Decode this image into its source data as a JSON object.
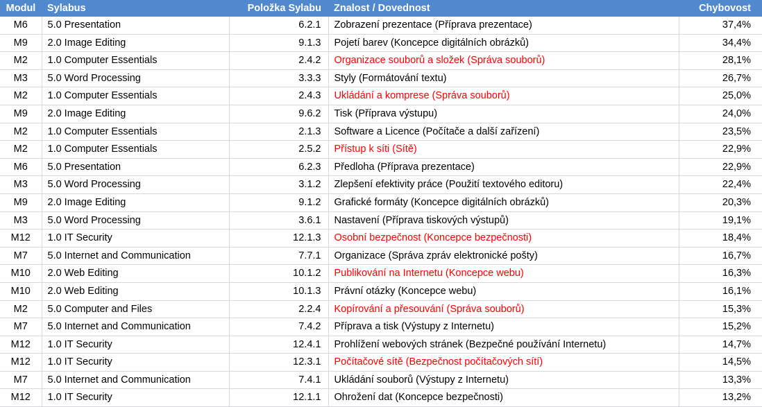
{
  "table": {
    "headers": {
      "modul": "Modul",
      "sylabus": "Sylabus",
      "polozka": "Položka Sylabu",
      "znalost": "Znalost / Dovednost",
      "chybovost": "Chybovost"
    },
    "colors": {
      "header_background": "#5089CE",
      "header_text": "#FFFFFF",
      "highlight_text": "#FF0000",
      "body_text": "#000000",
      "gridline": "#D3D9DE"
    },
    "rows": [
      {
        "modul": "M6",
        "sylabus": "5.0 Presentation",
        "polozka": "6.2.1",
        "znalost": "Zobrazení prezentace (Příprava prezentace)",
        "chybovost": "37,4%",
        "highlighted": false
      },
      {
        "modul": "M9",
        "sylabus": "2.0 Image Editing",
        "polozka": "9.1.3",
        "znalost": "Pojetí barev (Koncepce digitálních obrázků)",
        "chybovost": "34,4%",
        "highlighted": false
      },
      {
        "modul": "M2",
        "sylabus": "1.0 Computer Essentials",
        "polozka": "2.4.2",
        "znalost": "Organizace souborů a složek (Správa souborů)",
        "chybovost": "28,1%",
        "highlighted": true
      },
      {
        "modul": "M3",
        "sylabus": "5.0 Word Processing",
        "polozka": "3.3.3",
        "znalost": "Styly (Formátování textu)",
        "chybovost": "26,7%",
        "highlighted": false
      },
      {
        "modul": "M2",
        "sylabus": "1.0 Computer Essentials",
        "polozka": "2.4.3",
        "znalost": "Ukládání a komprese (Správa souborů)",
        "chybovost": "25,0%",
        "highlighted": true
      },
      {
        "modul": "M9",
        "sylabus": "2.0 Image Editing",
        "polozka": "9.6.2",
        "znalost": "Tisk (Příprava výstupu)",
        "chybovost": "24,0%",
        "highlighted": false
      },
      {
        "modul": "M2",
        "sylabus": "1.0 Computer Essentials",
        "polozka": "2.1.3",
        "znalost": "Software a Licence (Počítače a další zařízení)",
        "chybovost": "23,5%",
        "highlighted": false
      },
      {
        "modul": "M2",
        "sylabus": "1.0 Computer Essentials",
        "polozka": "2.5.2",
        "znalost": "Přístup k síti (Sítě)",
        "chybovost": "22,9%",
        "highlighted": true
      },
      {
        "modul": "M6",
        "sylabus": "5.0 Presentation",
        "polozka": "6.2.3",
        "znalost": "Předloha (Příprava prezentace)",
        "chybovost": "22,9%",
        "highlighted": false
      },
      {
        "modul": "M3",
        "sylabus": "5.0 Word Processing",
        "polozka": "3.1.2",
        "znalost": "Zlepšení efektivity práce (Použití textového editoru)",
        "chybovost": "22,4%",
        "highlighted": false
      },
      {
        "modul": "M9",
        "sylabus": "2.0 Image Editing",
        "polozka": "9.1.2",
        "znalost": "Grafické formáty (Koncepce digitálních obrázků)",
        "chybovost": "20,3%",
        "highlighted": false
      },
      {
        "modul": "M3",
        "sylabus": "5.0 Word Processing",
        "polozka": "3.6.1",
        "znalost": "Nastavení (Příprava tiskových výstupů)",
        "chybovost": "19,1%",
        "highlighted": false
      },
      {
        "modul": "M12",
        "sylabus": "1.0 IT Security",
        "polozka": "12.1.3",
        "znalost": "Osobní bezpečnost (Koncepce bezpečnosti)",
        "chybovost": "18,4%",
        "highlighted": true
      },
      {
        "modul": "M7",
        "sylabus": "5.0 Internet and Communication",
        "polozka": "7.7.1",
        "znalost": "Organizace (Správa zpráv elektronické pošty)",
        "chybovost": "16,7%",
        "highlighted": false
      },
      {
        "modul": "M10",
        "sylabus": "2.0 Web Editing",
        "polozka": "10.1.2",
        "znalost": "Publikování na Internetu (Koncepce webu)",
        "chybovost": "16,3%",
        "highlighted": true
      },
      {
        "modul": "M10",
        "sylabus": "2.0 Web Editing",
        "polozka": "10.1.3",
        "znalost": "Právní otázky (Koncepce webu)",
        "chybovost": "16,1%",
        "highlighted": false
      },
      {
        "modul": "M2",
        "sylabus": "5.0 Computer and Files",
        "polozka": "2.2.4",
        "znalost": "Kopírování a přesouvání (Správa souborů)",
        "chybovost": "15,3%",
        "highlighted": true
      },
      {
        "modul": "M7",
        "sylabus": "5.0 Internet and Communication",
        "polozka": "7.4.2",
        "znalost": "Příprava a tisk (Výstupy z Internetu)",
        "chybovost": "15,2%",
        "highlighted": false
      },
      {
        "modul": "M12",
        "sylabus": "1.0 IT Security",
        "polozka": "12.4.1",
        "znalost": "Prohlížení webových stránek (Bezpečné používání Internetu)",
        "chybovost": "14,7%",
        "highlighted": false
      },
      {
        "modul": "M12",
        "sylabus": "1.0 IT Security",
        "polozka": "12.3.1",
        "znalost": "Počítačové sítě (Bezpečnost počítačových sítí)",
        "chybovost": "14,5%",
        "highlighted": true
      },
      {
        "modul": "M7",
        "sylabus": "5.0 Internet and Communication",
        "polozka": "7.4.1",
        "znalost": "Ukládání souborů (Výstupy z Internetu)",
        "chybovost": "13,3%",
        "highlighted": false
      },
      {
        "modul": "M12",
        "sylabus": "1.0 IT Security",
        "polozka": "12.1.1",
        "znalost": "Ohrožení dat (Koncepce bezpečnosti)",
        "chybovost": "13,2%",
        "highlighted": false
      }
    ]
  }
}
